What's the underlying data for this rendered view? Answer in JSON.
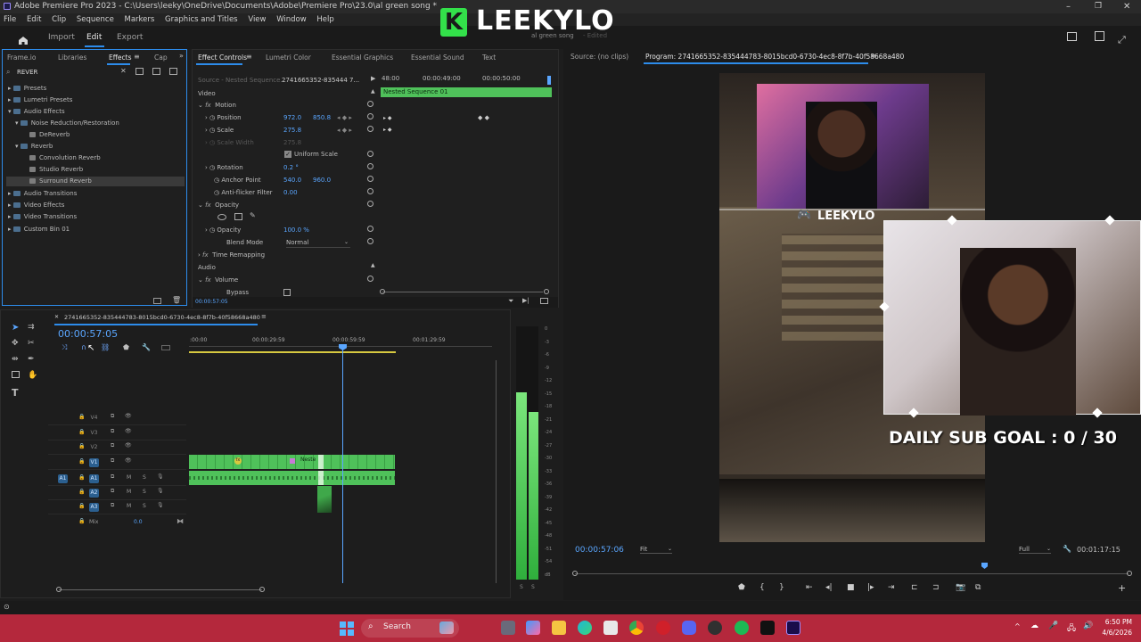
{
  "window": {
    "title": "Adobe Premiere Pro 2023 - C:\\Users\\leeky\\OneDrive\\Documents\\Adobe\\Premiere Pro\\23.0\\al green song *"
  },
  "menu": [
    "File",
    "Edit",
    "Clip",
    "Sequence",
    "Markers",
    "Graphics and Titles",
    "View",
    "Window",
    "Help"
  ],
  "workspaces": {
    "import": "Import",
    "edit": "Edit",
    "export": "Export"
  },
  "header_overlay": {
    "logo_letter": "K",
    "logo_name": "LEEKYLO",
    "subtitle": "al green song",
    "subtitle2": "- Edited"
  },
  "effects_panel": {
    "tabs": [
      "Frame.io",
      "Libraries",
      "Effects",
      "Cap"
    ],
    "search_value": "REVER",
    "items": [
      {
        "label": "Presets",
        "level": 0
      },
      {
        "label": "Lumetri Presets",
        "level": 0
      },
      {
        "label": "Audio Effects",
        "level": 0
      },
      {
        "label": "Noise Reduction/Restoration",
        "level": 1
      },
      {
        "label": "DeReverb",
        "level": 2
      },
      {
        "label": "Reverb",
        "level": 1
      },
      {
        "label": "Convolution Reverb",
        "level": 2
      },
      {
        "label": "Studio Reverb",
        "level": 2
      },
      {
        "label": "Surround Reverb",
        "level": 2
      },
      {
        "label": "Audio Transitions",
        "level": 0
      },
      {
        "label": "Video Effects",
        "level": 0
      },
      {
        "label": "Video Transitions",
        "level": 0
      },
      {
        "label": "Custom Bin 01",
        "level": 0
      }
    ]
  },
  "effect_controls": {
    "tabs": [
      "Effect Controls",
      "Lumetri Color",
      "Essential Graphics",
      "Essential Sound",
      "Text"
    ],
    "source": "Source - Nested Sequence...",
    "clip": "2741665352-835444 7...",
    "times": [
      "48:00",
      "00:00:49:00",
      "00:00:50:00"
    ],
    "nested_label": "Nested Sequence 01",
    "section_video": "Video",
    "motion": "Motion",
    "position_label": "Position",
    "position_x": "972.0",
    "position_y": "850.8",
    "scale_label": "Scale",
    "scale_value": "275.8",
    "scale_width_label": "Scale Width",
    "scale_width_value": "275.8",
    "uniform_scale": "Uniform Scale",
    "rotation_label": "Rotation",
    "rotation_value": "0.2 °",
    "anchor_label": "Anchor Point",
    "anchor_x": "540.0",
    "anchor_y": "960.0",
    "flicker_label": "Anti-flicker Filter",
    "flicker_value": "0.00",
    "opacity_section": "Opacity",
    "opacity_label": "Opacity",
    "opacity_value": "100.0 %",
    "blend_label": "Blend Mode",
    "blend_value": "Normal",
    "time_remap": "Time Remapping",
    "section_audio": "Audio",
    "volume": "Volume",
    "bypass": "Bypass",
    "timecode": "00:00:57:05"
  },
  "program_monitor": {
    "source_tab": "Source: (no clips)",
    "program_tab": "Program: 2741665352-835444783-8015bcd0-6730-4ec8-8f7b-40f58668a480",
    "timecode": "00:00:57:06",
    "fit": "Fit",
    "full": "Full",
    "duration": "00:01:17:15",
    "discord_name": "LEEKYLO",
    "sub_goal": "DAILY SUB GOAL : 0 / 30"
  },
  "timeline": {
    "sequence_name": "2741665352-835444783-8015bcd0-6730-4ec8-8f7b-40f58668a480",
    "timecode": "00:00:57:05",
    "ruler": [
      ":00:00",
      "00:00:29:59",
      "00:00:59:59",
      "00:01:29:59"
    ],
    "video_tracks": [
      "V4",
      "V3",
      "V2",
      "V1"
    ],
    "audio_tracks": [
      "A1",
      "A2",
      "A3"
    ],
    "mix_label": "Mix",
    "mix_value": "0.0",
    "clip_label": "Neste",
    "meter_scale": [
      "0",
      "-3",
      "-6",
      "-9",
      "-12",
      "-15",
      "-18",
      "-21",
      "-24",
      "-27",
      "-30",
      "-33",
      "-36",
      "-39",
      "-42",
      "-45",
      "-48",
      "-51",
      "-54",
      "dB"
    ],
    "meter_solo": [
      "S",
      "S"
    ]
  },
  "taskbar": {
    "search": "Search",
    "time": "6:50 PM",
    "date": "4/6/2026"
  },
  "colors": {
    "accent": "#2d8ceb",
    "clip_green": "#4fc15a",
    "taskbar": "#b4283c",
    "value_blue": "#5aa6ff"
  }
}
